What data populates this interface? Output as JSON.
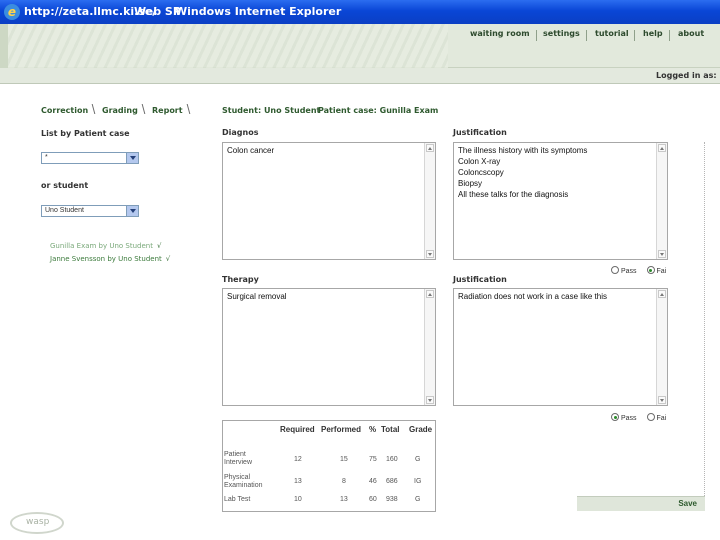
{
  "window": {
    "url": "http://zeta.llmc.ki.se/",
    "app": "Web SP",
    "browser": "Windows Internet Explorer"
  },
  "nav": {
    "items": [
      "waiting room",
      "settings",
      "tutorial",
      "help",
      "about"
    ]
  },
  "login": {
    "text": "Logged in as: U"
  },
  "tabs": [
    "Correction",
    "Grading",
    "Report"
  ],
  "breadcrumb": {
    "student": "Student: Uno Student",
    "patient_case": "Patient case: Gunilla Exam"
  },
  "left": {
    "list_by_label": "List by Patient case",
    "case_select_value": "*",
    "or_student_label": "or student",
    "student_select_value": "Uno Student",
    "cases": [
      {
        "label": "Gunilla Exam by Uno Student",
        "check": "√"
      },
      {
        "label": "Janne Svensson by Uno Student",
        "check": "√"
      }
    ]
  },
  "diagnos": {
    "label": "Diagnos",
    "text": "Colon cancer"
  },
  "justification1": {
    "label": "Justification",
    "lines": [
      "The illness history with its symptoms",
      "Colon X-ray",
      "Coloncscopy",
      "Biopsy",
      "All these talks for the diagnosis"
    ],
    "radio": {
      "pass": "Pass",
      "fail": "Fai",
      "selected": "fail"
    }
  },
  "therapy": {
    "label": "Therapy",
    "text": "Surgical removal"
  },
  "justification2": {
    "label": "Justification",
    "text": "Radiation does not work in a case like this",
    "radio": {
      "pass": "Pass",
      "fail": "Fai",
      "selected": "pass"
    }
  },
  "grades": {
    "headers": [
      "Required",
      "Performed",
      "%",
      "Total",
      "Grade"
    ],
    "rows": [
      {
        "label": "Patient Interview",
        "required": "12",
        "performed": "15",
        "percent": "75",
        "total": "160",
        "grade": "G"
      },
      {
        "label": "Physical Examination",
        "required": "13",
        "performed": "8",
        "percent": "46",
        "total": "686",
        "grade": "IG"
      },
      {
        "label": "Lab Test",
        "required": "10",
        "performed": "13",
        "percent": "60",
        "total": "938",
        "grade": "G"
      }
    ]
  },
  "save": {
    "label": "Save"
  },
  "logo": {
    "text": "wasp"
  }
}
